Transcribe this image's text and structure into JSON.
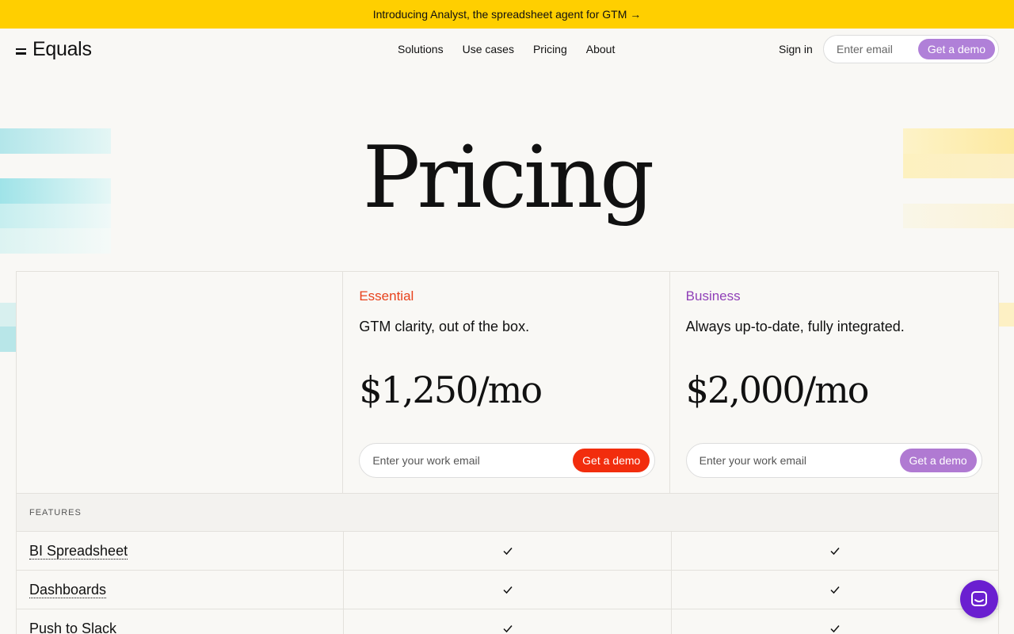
{
  "announcement": "Introducing Analyst, the spreadsheet agent for GTM →",
  "nav": {
    "logo": "Equals",
    "links": [
      "Solutions",
      "Use cases",
      "Pricing",
      "About"
    ],
    "signin": "Sign in",
    "email_placeholder": "Enter email",
    "demo_label": "Get a demo"
  },
  "hero": {
    "title": "Pricing"
  },
  "plans": [
    {
      "name": "Essential",
      "tagline": "GTM clarity, out of the box.",
      "price": "$1,250/mo",
      "email_placeholder": "Enter your work email",
      "cta": "Get a demo",
      "accent": "#e8421c",
      "button_color": "#f22d0d"
    },
    {
      "name": "Business",
      "tagline": "Always up-to-date, fully integrated.",
      "price": "$2,000/mo",
      "email_placeholder": "Enter your work email",
      "cta": "Get a demo",
      "accent": "#9040b8",
      "button_color": "#b07ad2"
    }
  ],
  "features": {
    "heading": "FEATURES",
    "rows": [
      {
        "name": "BI Spreadsheet",
        "essential": true,
        "business": true
      },
      {
        "name": "Dashboards",
        "essential": true,
        "business": true
      },
      {
        "name": "Push to Slack",
        "essential": true,
        "business": true
      }
    ]
  },
  "colors": {
    "banner": "#ffcf00",
    "chat": "#6a1fd0"
  },
  "icons": {
    "check": "check-icon",
    "chat": "chat-icon",
    "logo": "equals-logo-icon"
  }
}
